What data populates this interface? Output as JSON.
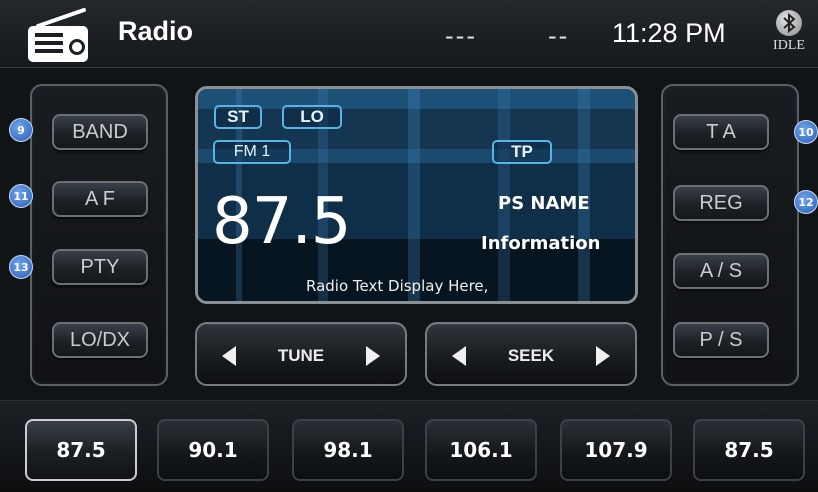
{
  "header": {
    "title": "Radio",
    "indicator_left": "---",
    "indicator_right": "--",
    "time": "11:28 PM",
    "bluetooth_status": "IDLE"
  },
  "left_buttons": [
    {
      "label": "BAND",
      "badge": "9"
    },
    {
      "label": "A F",
      "badge": "11"
    },
    {
      "label": "PTY",
      "badge": "13"
    },
    {
      "label": "LO/DX",
      "badge": ""
    }
  ],
  "right_buttons": [
    {
      "label": "T A",
      "badge": "10"
    },
    {
      "label": "REG",
      "badge": "12"
    },
    {
      "label": "A / S",
      "badge": ""
    },
    {
      "label": "P / S",
      "badge": ""
    }
  ],
  "display": {
    "st_label": "ST",
    "lo_label": "LO",
    "band_label": "FM 1",
    "tp_label": "TP",
    "frequency": "87.5",
    "ps_name": "PS NAME",
    "information": "Information",
    "radio_text": "Radio Text Display Here,"
  },
  "controls": {
    "tune_label": "TUNE",
    "seek_label": "SEEK"
  },
  "presets": [
    {
      "label": "87.5",
      "active": true
    },
    {
      "label": "90.1",
      "active": false
    },
    {
      "label": "98.1",
      "active": false
    },
    {
      "label": "106.1",
      "active": false
    },
    {
      "label": "107.9",
      "active": false
    },
    {
      "label": "87.5",
      "active": false
    }
  ],
  "colors": {
    "accent_blue": "#56b4e6",
    "badge_blue": "#3a72cc",
    "background": "#111417"
  },
  "icons": {
    "header_icon": "radio-icon",
    "status_icon": "bluetooth-icon",
    "tune_seek_icons": [
      "arrow-left-icon",
      "arrow-right-icon"
    ]
  }
}
